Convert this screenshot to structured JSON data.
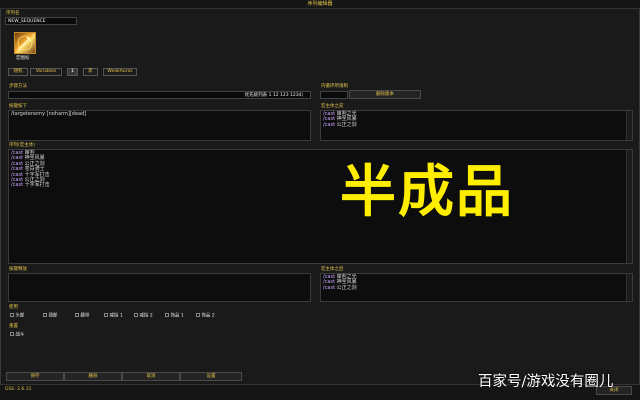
{
  "window": {
    "title": "序列编辑器"
  },
  "sequence": {
    "name_label": "序列名",
    "name_value": "NEW_SEQUENCE",
    "icon_label": "宏图标"
  },
  "tabs": [
    {
      "label": "随机"
    },
    {
      "label": "Variables"
    },
    {
      "label": "1"
    },
    {
      "label": "新"
    },
    {
      "label": "WeakAuras"
    }
  ],
  "step": {
    "label": "步骤方法",
    "value": "优先级列表 1 12 123 1234）",
    "inner_loop_label": "内循环所限制",
    "delete_version_button": "删除版本"
  },
  "keypress": {
    "label": "按键按下",
    "lines": [
      "/targetenemy [noharm][dead]"
    ]
  },
  "pre_macro": {
    "label": "宏主体之前",
    "lines": [
      {
        "cmd": "/cast",
        "text": "审判之光"
      },
      {
        "cmd": "/cast",
        "text": "神圣风暴"
      },
      {
        "cmd": "/cast",
        "text": "公正之剑"
      }
    ]
  },
  "sequence_body": {
    "label": "序列(宏主体)",
    "lines": [
      {
        "cmd": "/cast",
        "text": "审判"
      },
      {
        "cmd": "/cast",
        "text": "神圣风暴"
      },
      {
        "cmd": "/cast",
        "text": "公正之剑"
      },
      {
        "cmd": "/cast",
        "text": "苍白骑士"
      },
      {
        "cmd": "/cast",
        "text": "十字军打击"
      },
      {
        "cmd": "/cast",
        "text": "公正之剑"
      },
      {
        "cmd": "/cast",
        "text": "十字军打击"
      }
    ]
  },
  "keyrelease": {
    "label": "按键释放",
    "lines": []
  },
  "post_macro": {
    "label": "宏主体之后",
    "lines": [
      {
        "cmd": "/cast",
        "text": "审判之光"
      },
      {
        "cmd": "/cast",
        "text": "神圣风暴"
      },
      {
        "cmd": "/cast",
        "text": "公正之剑"
      }
    ]
  },
  "use_section": {
    "label": "使用",
    "checkboxes": [
      {
        "label": "头部"
      },
      {
        "label": "颈部"
      },
      {
        "label": "腰带"
      },
      {
        "label": "戒指 1"
      },
      {
        "label": "戒指 2"
      },
      {
        "label": "饰品 1"
      },
      {
        "label": "饰品 2"
      }
    ]
  },
  "reset_section": {
    "label": "重置",
    "checkboxes": [
      {
        "label": "战斗"
      }
    ]
  },
  "bottom_buttons": {
    "save": "保存",
    "delete": "删除",
    "cancel": "取消",
    "settings": "设置",
    "close": "关闭"
  },
  "status": {
    "version": "GSE: 2.6.31"
  },
  "overlay": {
    "big_text": "半成品",
    "watermark": "百家号/游戏没有圈儿"
  },
  "colors": {
    "accent": "#e0c24a",
    "keyword": "#c9a3ff",
    "overlay_text": "#ffee00"
  }
}
